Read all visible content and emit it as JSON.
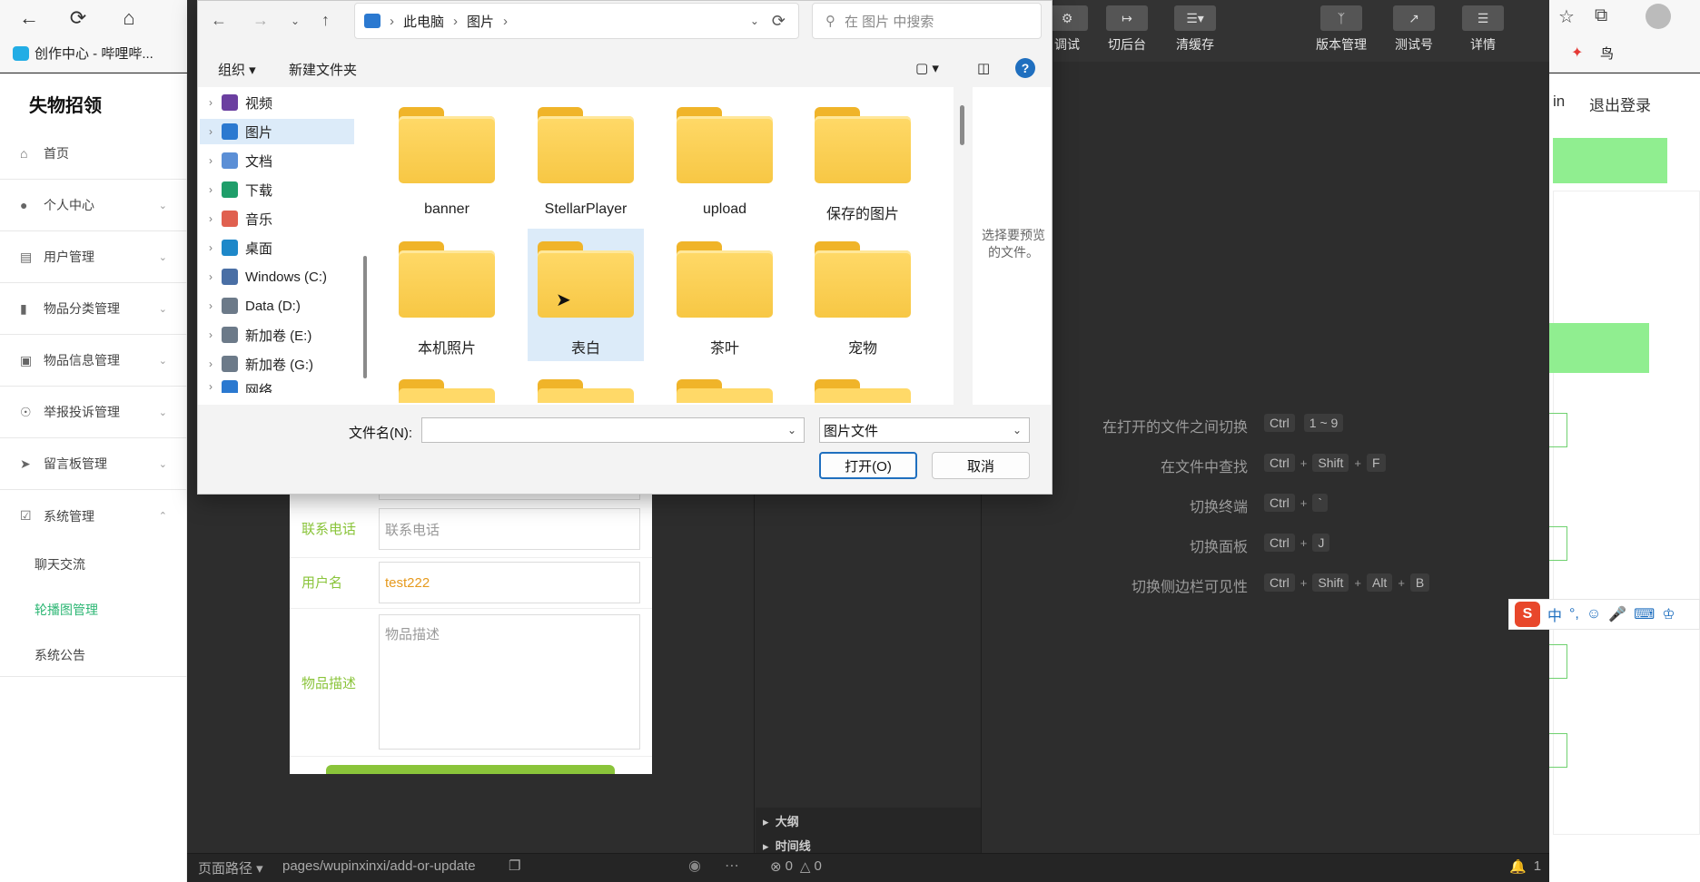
{
  "browser": {
    "bookmark1": "创作中心 - 哔哩哔...",
    "bookmark_right": "鸟"
  },
  "app": {
    "title": "失物招领",
    "menu": [
      {
        "label": "首页",
        "icon": "home-icon"
      },
      {
        "label": "个人中心",
        "icon": "user-icon"
      },
      {
        "label": "用户管理",
        "icon": "clipboard-icon"
      },
      {
        "label": "物品分类管理",
        "icon": "bar-chart-icon"
      },
      {
        "label": "物品信息管理",
        "icon": "box-icon"
      },
      {
        "label": "举报投诉管理",
        "icon": "target-icon"
      },
      {
        "label": "留言板管理",
        "icon": "send-icon"
      },
      {
        "label": "系统管理",
        "icon": "check-icon"
      }
    ],
    "submenu": [
      "聊天交流",
      "轮播图管理",
      "系统公告"
    ],
    "header_right": [
      "in",
      "退出登录"
    ]
  },
  "editor": {
    "toolbar": [
      "调试",
      "切后台",
      "清缓存",
      "版本管理",
      "测试号",
      "详情"
    ],
    "form": {
      "phone_label": "联系电话",
      "phone_placeholder": "联系电话",
      "username_label": "用户名",
      "username_value": "test222",
      "desc_label": "物品描述",
      "desc_placeholder": "物品描述"
    },
    "shortcuts": [
      {
        "label": "在打开的文件之间切换",
        "keys": [
          "Ctrl",
          "1 ~ 9"
        ],
        "plus": false
      },
      {
        "label": "在文件中查找",
        "keys": [
          "Ctrl",
          "Shift",
          "F"
        ],
        "plus": true
      },
      {
        "label": "切换终端",
        "keys": [
          "Ctrl",
          "`"
        ],
        "plus": true
      },
      {
        "label": "切换面板",
        "keys": [
          "Ctrl",
          "J"
        ],
        "plus": true
      },
      {
        "label": "切换侧边栏可见性",
        "keys": [
          "Ctrl",
          "Shift",
          "Alt",
          "B"
        ],
        "plus": true
      }
    ],
    "outline": [
      "大纲",
      "时间线"
    ],
    "status": {
      "path_label": "页面路径",
      "path": "pages/wupinxinxi/add-or-update",
      "errors": "0",
      "warnings": "0",
      "notifications": "1"
    }
  },
  "dialog": {
    "breadcrumb": [
      "此电脑",
      "图片"
    ],
    "search_placeholder": "在 图片 中搜索",
    "organize": "组织",
    "new_folder": "新建文件夹",
    "tree": [
      {
        "label": "视频",
        "color": "#6b3fa0"
      },
      {
        "label": "图片",
        "color": "#2b79d0",
        "selected": true
      },
      {
        "label": "文档",
        "color": "#5b8fd6"
      },
      {
        "label": "下载",
        "color": "#1f9e6a"
      },
      {
        "label": "音乐",
        "color": "#e0604f"
      },
      {
        "label": "桌面",
        "color": "#1e88c9"
      },
      {
        "label": "Windows (C:)",
        "color": "#4a6fa5"
      },
      {
        "label": "Data (D:)",
        "color": "#6c7a89"
      },
      {
        "label": "新加卷 (E:)",
        "color": "#6c7a89"
      },
      {
        "label": "新加卷 (G:)",
        "color": "#6c7a89"
      },
      {
        "label": "网络",
        "color": "#2b79d0"
      }
    ],
    "folders": [
      "banner",
      "StellarPlayer",
      "upload",
      "保存的图片",
      "本机照片",
      "表白",
      "茶叶",
      "宠物"
    ],
    "preview_text": "选择要预览的文件。",
    "filename_label": "文件名(N):",
    "filename_value": "",
    "filetype": "图片文件",
    "open_button": "打开(O)",
    "cancel_button": "取消"
  },
  "ime": {
    "mode": "中",
    "punct": "°,"
  }
}
